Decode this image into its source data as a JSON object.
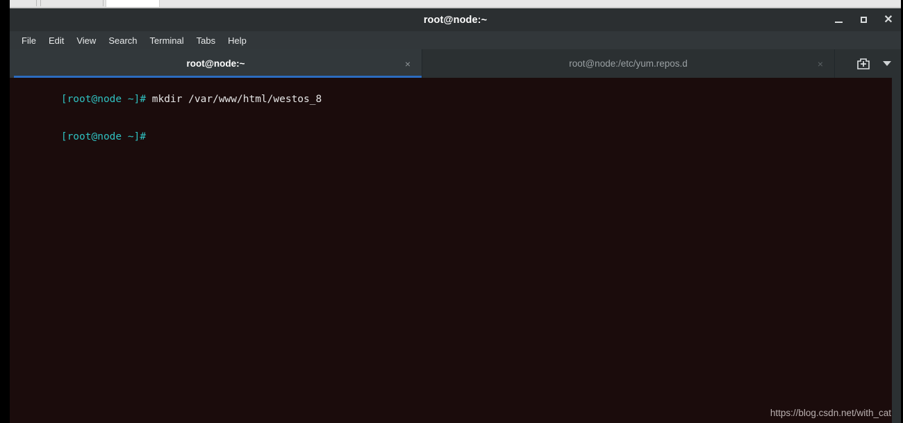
{
  "window": {
    "title": "root@node:~",
    "controls": {
      "minimize_label": "Minimize",
      "maximize_label": "Maximize",
      "close_label": "Close"
    }
  },
  "menubar": {
    "items": [
      {
        "label": "File"
      },
      {
        "label": "Edit"
      },
      {
        "label": "View"
      },
      {
        "label": "Search"
      },
      {
        "label": "Terminal"
      },
      {
        "label": "Tabs"
      },
      {
        "label": "Help"
      }
    ]
  },
  "tabbar": {
    "tabs": [
      {
        "label": "root@node:~",
        "active": true,
        "close_glyph": "×"
      },
      {
        "label": "root@node:/etc/yum.repos.d",
        "active": false,
        "close_glyph": "×"
      }
    ],
    "new_tab_label": "New Tab",
    "dropdown_label": "Tab list"
  },
  "terminal": {
    "lines": [
      {
        "prompt": "[root@node ~]# ",
        "command": "mkdir /var/www/html/westos_8"
      },
      {
        "prompt": "[root@node ~]#",
        "command": ""
      }
    ]
  },
  "watermark": {
    "text": "https://blog.csdn.net/with_cat"
  },
  "colors": {
    "accent_blue": "#2c6cbf",
    "titlebar": "#2b2f31",
    "menubar": "#32373a",
    "tabbar": "#2b3032",
    "terminal_bg": "#1b0c0c",
    "prompt_cyan": "#2fc0c0",
    "command_text": "#e6e6e6"
  }
}
